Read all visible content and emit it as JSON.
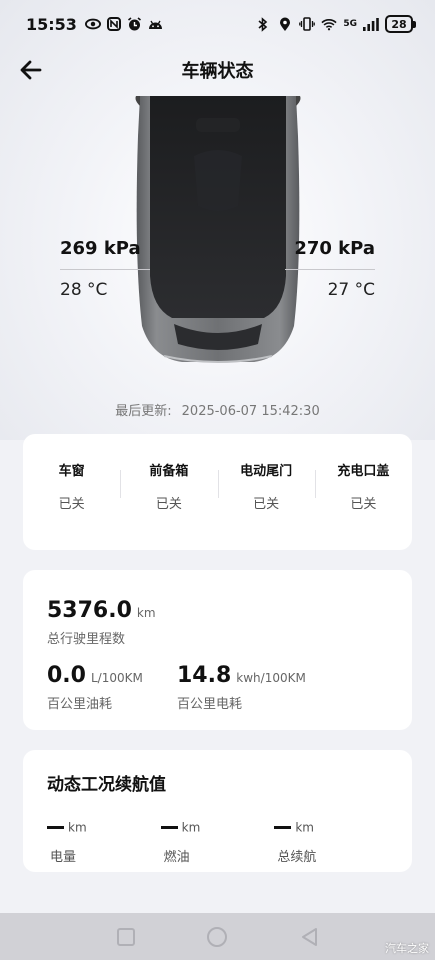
{
  "status_bar": {
    "time": "15:53",
    "network_label": "5G",
    "battery": "28"
  },
  "header": {
    "title": "车辆状态",
    "back_icon": "arrow-left-icon"
  },
  "tires": {
    "front_left": {
      "pressure": "269 kPa",
      "temperature": "28 °C"
    },
    "front_right": {
      "pressure": "270 kPa",
      "temperature": "27 °C"
    }
  },
  "last_updated": {
    "label": "最后更新:",
    "value": "2025-06-07 15:42:30"
  },
  "doors": [
    {
      "name": "车窗",
      "state": "已关"
    },
    {
      "name": "前备箱",
      "state": "已关"
    },
    {
      "name": "电动尾门",
      "state": "已关"
    },
    {
      "name": "充电口盖",
      "state": "已关"
    }
  ],
  "stats": {
    "odometer": {
      "value": "5376.0",
      "unit": "km",
      "label": "总行驶里程数"
    },
    "fuel": {
      "value": "0.0",
      "unit": "L/100KM",
      "label": "百公里油耗"
    },
    "energy": {
      "value": "14.8",
      "unit": "kwh/100KM",
      "label": "百公里电耗"
    }
  },
  "range": {
    "title": "动态工况续航值",
    "items": [
      {
        "unit": "km",
        "label": "电量"
      },
      {
        "unit": "km",
        "label": "燃油"
      },
      {
        "unit": "km",
        "label": "总续航"
      }
    ]
  },
  "watermark": "汽车之家",
  "colors": {
    "background": "#f1f2f6",
    "card": "#ffffff",
    "car_body": "#3a3c3e",
    "navbar": "#d1d1d6"
  }
}
